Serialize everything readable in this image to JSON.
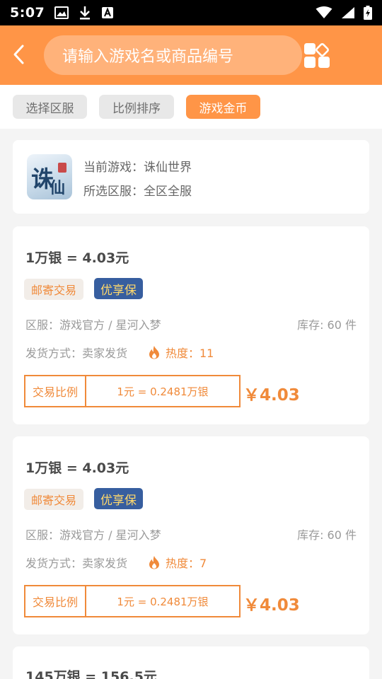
{
  "status_bar": {
    "time": "5:07"
  },
  "header": {
    "search_placeholder": "请输入游戏名或商品编号"
  },
  "filters": [
    {
      "label": "选择区服",
      "active": false
    },
    {
      "label": "比例排序",
      "active": false
    },
    {
      "label": "游戏金币",
      "active": true
    }
  ],
  "game": {
    "current": "当前游戏：诛仙世界",
    "server": "所选区服：全区全服"
  },
  "listings": [
    {
      "title": "1万银 = 4.03元",
      "tag_mail": "邮寄交易",
      "tag_safe": "优享保",
      "server": "区服：游戏官方 / 星河入梦",
      "stock": "库存: 60 件",
      "delivery": "发货方式：卖家发货",
      "heat": "热度：11",
      "ratio_label": "交易比例",
      "ratio": "1元 = 0.2481万银",
      "price": "￥4.03"
    },
    {
      "title": "1万银 = 4.03元",
      "tag_mail": "邮寄交易",
      "tag_safe": "优享保",
      "server": "区服：游戏官方 / 星河入梦",
      "stock": "库存: 60 件",
      "delivery": "发货方式：卖家发货",
      "heat": "热度：7",
      "ratio_label": "交易比例",
      "ratio": "1元 = 0.2481万银",
      "price": "￥4.03"
    },
    {
      "title": "145万银 = 156.5元"
    }
  ],
  "colors": {
    "accent": "#ff9547",
    "accent_text": "#f08a3a",
    "safe_tag": "#375e9f"
  }
}
